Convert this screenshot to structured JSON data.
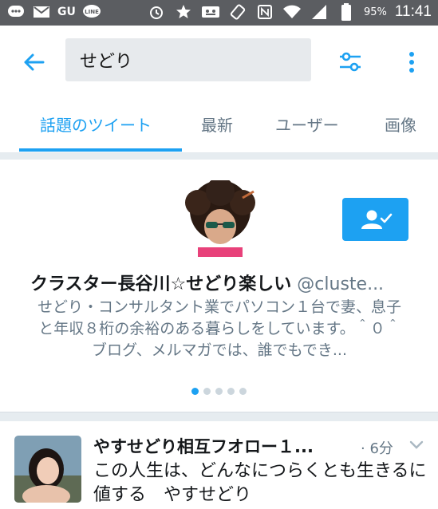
{
  "status_bar": {
    "carrier": "GU",
    "battery_pct": "95%",
    "time": "11:41",
    "icons_left": [
      "chat-bubble-icon",
      "gmail-icon",
      "gu-icon",
      "line-icon"
    ],
    "icons_right": [
      "alarm-icon",
      "star-icon",
      "voicemail-icon",
      "rotate-icon",
      "nfc-icon",
      "wifi-icon",
      "signal-icon",
      "battery-icon"
    ]
  },
  "search": {
    "query": "せどり"
  },
  "tabs": [
    {
      "label": "話題のツイート",
      "active": true
    },
    {
      "label": "最新",
      "active": false
    },
    {
      "label": "ユーザー",
      "active": false
    },
    {
      "label": "画像",
      "active": false
    }
  ],
  "user_card": {
    "name": "クラスター長谷川☆せどり楽しい",
    "handle": "@cluste...",
    "bio": "せどり・コンサルタント業でパソコン１台で妻、息子と年収８桁の余裕のある暮らしをしています。＾０＾ブログ、メルマガでは、誰でもでき...",
    "carousel_total": 5,
    "carousel_active": 0
  },
  "tweet": {
    "name": "やすせどり相互フオロー１...",
    "time": "· 6分",
    "text": "この人生は、どんなにつらくとも生きるに値する　やすせどり"
  },
  "colors": {
    "accent": "#1da1f2",
    "status_bar": "#5b5d61",
    "secondary_text": "#657786",
    "primary_text": "#14171a",
    "search_bg": "#e7eaed"
  }
}
